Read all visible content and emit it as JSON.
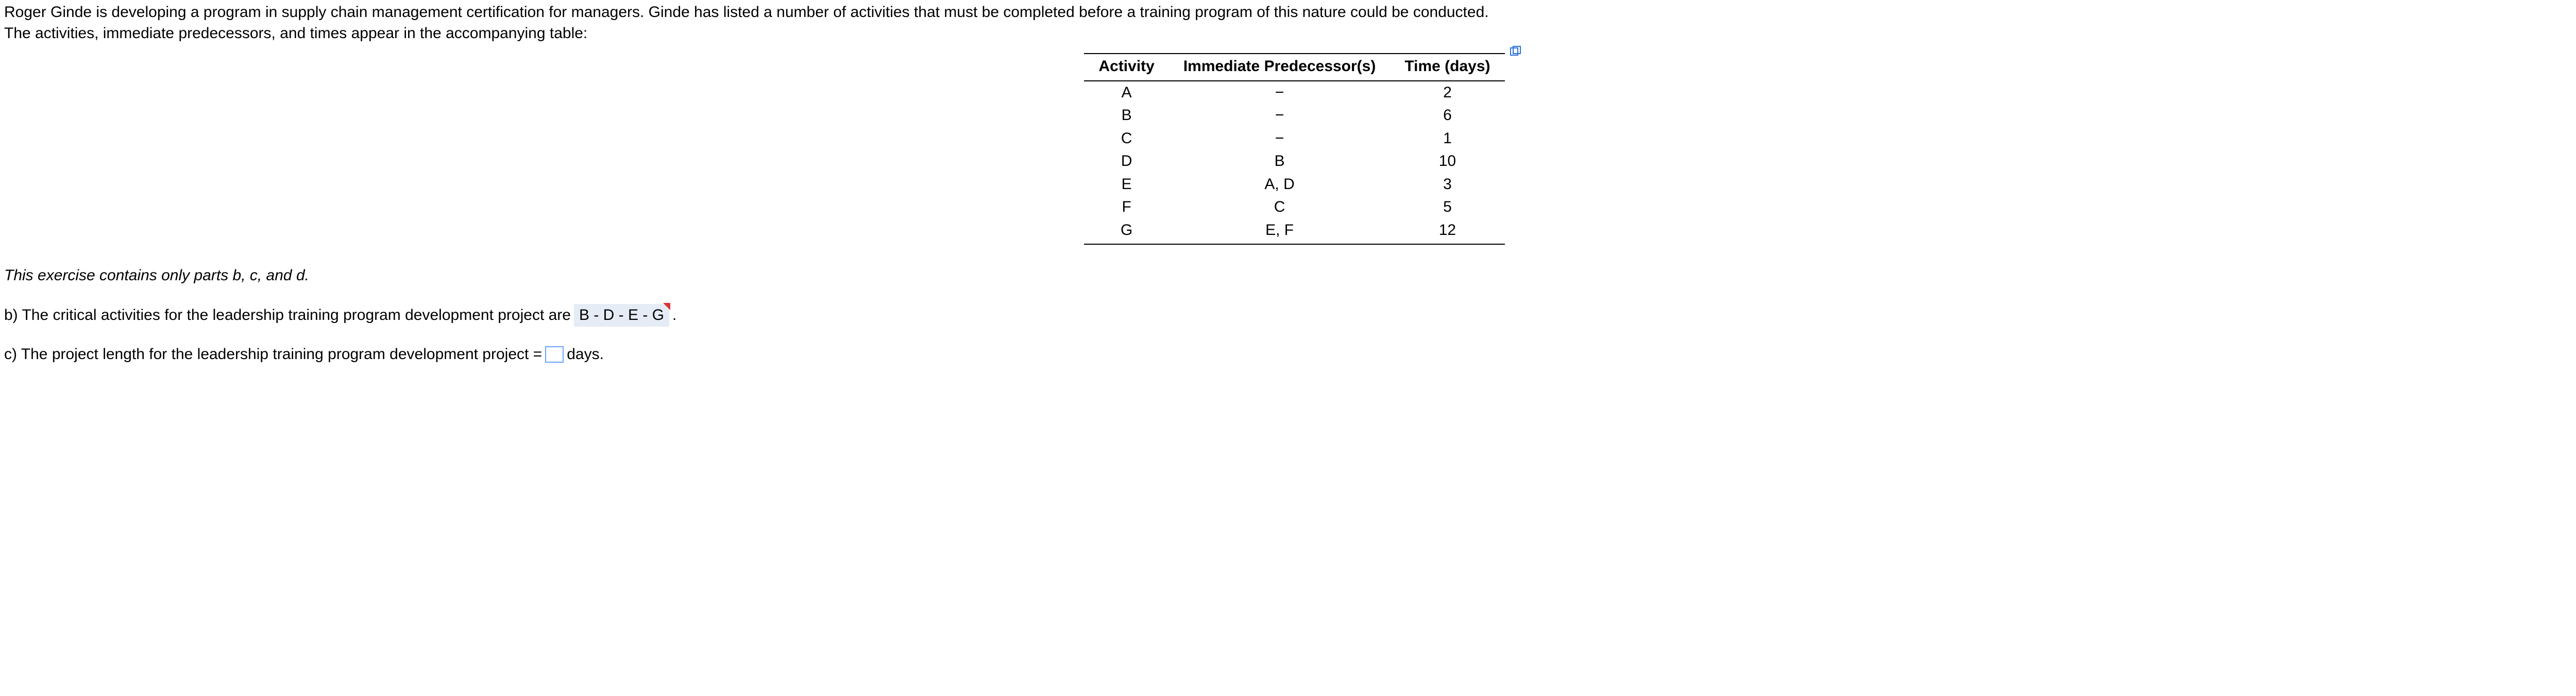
{
  "intro": {
    "line1": "Roger Ginde is developing a program in supply chain management certification for managers. Ginde has listed a number of activities that must be completed before a training program of this nature could be conducted.",
    "line2": "The activities, immediate predecessors, and times appear in the accompanying table:"
  },
  "table": {
    "headers": {
      "activity": "Activity",
      "predecessor": "Immediate Predecessor(s)",
      "time": "Time (days)"
    },
    "rows": [
      {
        "activity": "A",
        "predecessor": "−",
        "time": "2"
      },
      {
        "activity": "B",
        "predecessor": "−",
        "time": "6"
      },
      {
        "activity": "C",
        "predecessor": "−",
        "time": "1"
      },
      {
        "activity": "D",
        "predecessor": "B",
        "time": "10"
      },
      {
        "activity": "E",
        "predecessor": "A, D",
        "time": "3"
      },
      {
        "activity": "F",
        "predecessor": "C",
        "time": "5"
      },
      {
        "activity": "G",
        "predecessor": "E, F",
        "time": "12"
      }
    ]
  },
  "parts_note": "This exercise contains only parts b, c, and d.",
  "part_b": {
    "prefix": "b) The critical activities for the leadership training program development project are",
    "answer": "B - D - E - G",
    "suffix": "."
  },
  "part_c": {
    "prefix": "c) The project length for the leadership training program development project =",
    "suffix": "days."
  },
  "icons": {
    "popout": "popout"
  }
}
